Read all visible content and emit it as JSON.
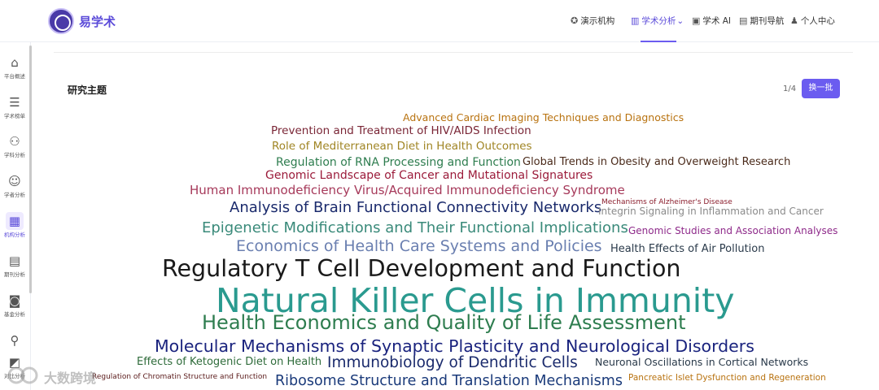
{
  "app": {
    "brand": "易学术"
  },
  "header": {
    "nav": [
      {
        "label": "演示机构",
        "icon": "institution-icon"
      },
      {
        "label": "学术分析",
        "icon": "chart-icon",
        "caret": "⌄",
        "active": true
      },
      {
        "label": "学术 AI",
        "icon": "ai-icon"
      },
      {
        "label": "期刊导航",
        "icon": "journal-icon"
      },
      {
        "label": "个人中心",
        "icon": "user-icon"
      }
    ]
  },
  "sidebar": {
    "items": [
      {
        "label": "平台概述",
        "icon": "home-icon"
      },
      {
        "label": "学术榜单",
        "icon": "list-icon"
      },
      {
        "label": "学科分析",
        "icon": "hierarchy-icon"
      },
      {
        "label": "学者分析",
        "icon": "people-icon"
      },
      {
        "label": "机构分析",
        "icon": "building-icon",
        "active": true
      },
      {
        "label": "期刊分析",
        "icon": "document-icon"
      },
      {
        "label": "基金分析",
        "icon": "fund-icon"
      },
      {
        "label": "",
        "icon": "location-icon"
      },
      {
        "label": "对比分析",
        "icon": "compare-icon"
      }
    ]
  },
  "main": {
    "section_title": "研究主题",
    "pager": "1/4",
    "batch_button": "换一批"
  },
  "wordcloud": [
    {
      "text": "Advanced Cardiac Imaging Techniques and Diagnostics",
      "color": "#b8720f"
    },
    {
      "text": "Prevention and Treatment of HIV/AIDS Infection",
      "color": "#7a2636"
    },
    {
      "text": "Role of Mediterranean Diet in Health Outcomes",
      "color": "#a08524"
    },
    {
      "text": "Regulation of RNA Processing and Function",
      "color": "#2e7d4f"
    },
    {
      "text": "Global Trends in Obesity and Overweight Research",
      "color": "#4a2a1a"
    },
    {
      "text": "Genomic Landscape of Cancer and Mutational Signatures",
      "color": "#9b1b3a"
    },
    {
      "text": "Human Immunodeficiency Virus/Acquired Immunodeficiency Syndrome",
      "color": "#a6395a"
    },
    {
      "text": "Analysis of Brain Functional Connectivity Networks",
      "color": "#1a2a6c"
    },
    {
      "text": "Mechanisms of Alzheimer's Disease",
      "color": "#8b1e2d"
    },
    {
      "text": "Integrin Signaling in Inflammation and Cancer",
      "color": "#8a8a8a"
    },
    {
      "text": "Epigenetic Modifications and Their Functional Implications",
      "color": "#3a8a7a"
    },
    {
      "text": "Genomic Studies and Association Analyses",
      "color": "#8e2a8a"
    },
    {
      "text": "Economics of Health Care Systems and Policies",
      "color": "#6a7fb0"
    },
    {
      "text": "Health Effects of Air Pollution",
      "color": "#2a3a4a"
    },
    {
      "text": "Regulatory T Cell Development and Function",
      "color": "#1a1a1a"
    },
    {
      "text": "Natural Killer Cells in Immunity",
      "color": "#2a9a8f"
    },
    {
      "text": "Health Economics and Quality of Life Assessment",
      "color": "#2e7d4f"
    },
    {
      "text": "Molecular Mechanisms of Synaptic Plasticity and Neurological Disorders",
      "color": "#1a237e"
    },
    {
      "text": "Effects of Ketogenic Diet on Health",
      "color": "#2e6b3a"
    },
    {
      "text": "Immunobiology of Dendritic Cells",
      "color": "#1a2a6c"
    },
    {
      "text": "Neuronal Oscillations in Cortical Networks",
      "color": "#2a3a4a"
    },
    {
      "text": "Regulation of Chromatin Structure and Function",
      "color": "#5a1a1a"
    },
    {
      "text": "Ribosome Structure and Translation Mechanisms",
      "color": "#1a3a7a"
    },
    {
      "text": "Pancreatic Islet Dysfunction and Regeneration",
      "color": "#b8720f"
    }
  ],
  "watermark": "大数跨境"
}
